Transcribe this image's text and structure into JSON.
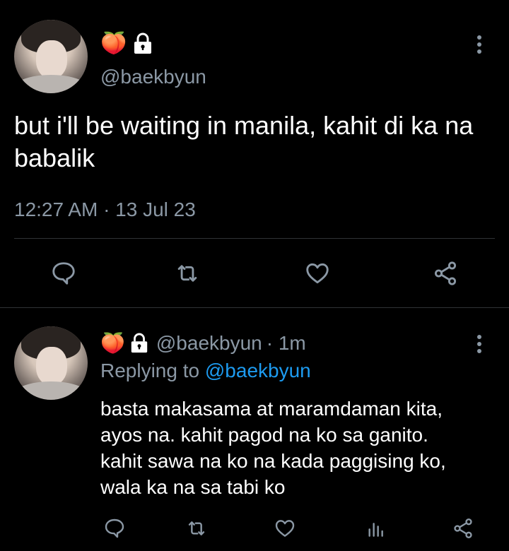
{
  "main_tweet": {
    "display_name_emoji": "🍑",
    "handle": "@baekbyun",
    "text": "but i'll be waiting in manila, kahit di ka na babalik",
    "timestamp": "12:27 AM · 13 Jul 23"
  },
  "reply": {
    "display_name_emoji": "🍑",
    "handle": "@baekbyun",
    "time_ago": "· 1m",
    "replying_to_label": "Replying to",
    "replying_to_handle": "@baekbyun",
    "text": "basta makasama at maramdaman kita, ayos na. kahit pagod na ko sa ganito. kahit sawa na ko na kada paggising ko, wala ka na sa tabi ko"
  },
  "icons": {
    "lock": "lock-icon",
    "more": "more-vertical-icon",
    "reply": "reply-icon",
    "retweet": "retweet-icon",
    "like": "like-icon",
    "share": "share-icon",
    "analytics": "analytics-icon"
  },
  "colors": {
    "background": "#000000",
    "secondary_text": "#8b98a5",
    "link": "#1d9bf0",
    "divider": "#2f3336"
  }
}
